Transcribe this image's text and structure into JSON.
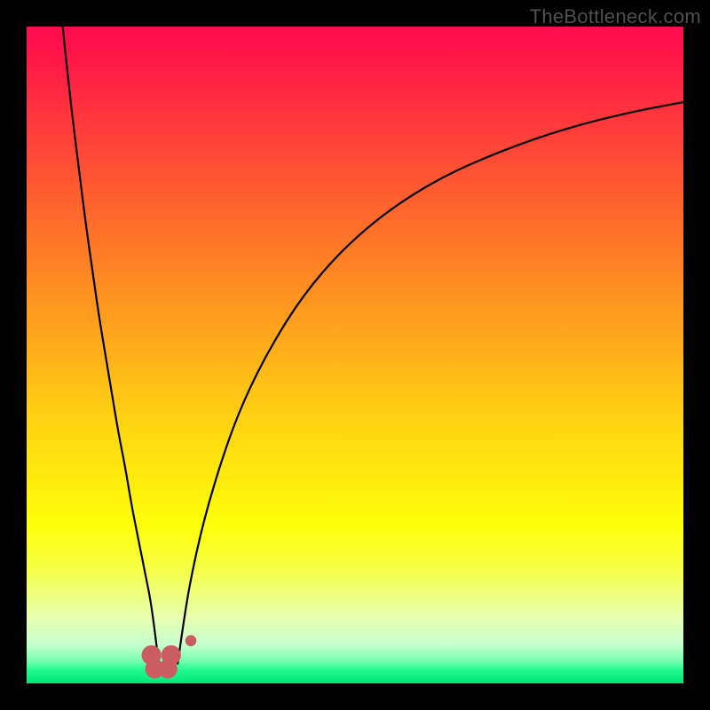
{
  "watermark": "TheBottleneck.com",
  "chart_data": {
    "type": "line",
    "title": "",
    "xlabel": "",
    "ylabel": "",
    "xlim": [
      0,
      100
    ],
    "ylim": [
      0,
      100
    ],
    "grid": false,
    "gradient_stops": [
      {
        "offset": 0.0,
        "color": "#ff0c52"
      },
      {
        "offset": 0.03,
        "color": "#ff1149"
      },
      {
        "offset": 0.35,
        "color": "#ff7e25"
      },
      {
        "offset": 0.6,
        "color": "#ffd312"
      },
      {
        "offset": 0.76,
        "color": "#feff0b"
      },
      {
        "offset": 0.82,
        "color": "#f7ff3f"
      },
      {
        "offset": 0.9,
        "color": "#e8ffb0"
      },
      {
        "offset": 0.94,
        "color": "#c7ffce"
      },
      {
        "offset": 0.965,
        "color": "#7bffb2"
      },
      {
        "offset": 0.98,
        "color": "#21f98d"
      },
      {
        "offset": 1.0,
        "color": "#00e877"
      }
    ],
    "series": [
      {
        "name": "left-curve",
        "stroke": "#000000",
        "width": 2.2,
        "points": [
          {
            "x": 5.5,
            "y": 100
          },
          {
            "x": 6.0,
            "y": 95
          },
          {
            "x": 7.0,
            "y": 86
          },
          {
            "x": 8.0,
            "y": 78
          },
          {
            "x": 9.0,
            "y": 70
          },
          {
            "x": 10.0,
            "y": 63
          },
          {
            "x": 11.0,
            "y": 56
          },
          {
            "x": 12.0,
            "y": 50
          },
          {
            "x": 13.0,
            "y": 44
          },
          {
            "x": 14.0,
            "y": 38
          },
          {
            "x": 15.0,
            "y": 33
          },
          {
            "x": 16.0,
            "y": 27
          },
          {
            "x": 17.0,
            "y": 22
          },
          {
            "x": 18.0,
            "y": 17
          },
          {
            "x": 19.0,
            "y": 12
          },
          {
            "x": 20.0,
            "y": 4
          }
        ]
      },
      {
        "name": "right-curve",
        "stroke": "#000000",
        "width": 2.2,
        "points": [
          {
            "x": 23.0,
            "y": 3
          },
          {
            "x": 24.0,
            "y": 10
          },
          {
            "x": 25.0,
            "y": 16
          },
          {
            "x": 27.0,
            "y": 25
          },
          {
            "x": 30.0,
            "y": 35
          },
          {
            "x": 33.0,
            "y": 43
          },
          {
            "x": 37.0,
            "y": 51
          },
          {
            "x": 42.0,
            "y": 59
          },
          {
            "x": 48.0,
            "y": 66
          },
          {
            "x": 55.0,
            "y": 72
          },
          {
            "x": 63.0,
            "y": 77
          },
          {
            "x": 72.0,
            "y": 81
          },
          {
            "x": 82.0,
            "y": 84.5
          },
          {
            "x": 92.0,
            "y": 87
          },
          {
            "x": 100.0,
            "y": 88.5
          }
        ]
      }
    ],
    "markers": [
      {
        "name": "blob-left",
        "cx": 19.0,
        "cy": 4.3,
        "r": 1.5,
        "color": "#cb5d62"
      },
      {
        "name": "blob-bottom-l",
        "cx": 19.5,
        "cy": 2.2,
        "r": 1.45,
        "color": "#cb5d62"
      },
      {
        "name": "blob-bottom-r",
        "cx": 21.5,
        "cy": 2.2,
        "r": 1.45,
        "color": "#cb5d62"
      },
      {
        "name": "blob-right",
        "cx": 22.0,
        "cy": 4.3,
        "r": 1.5,
        "color": "#cb5d62"
      },
      {
        "name": "dot-separate",
        "cx": 25.0,
        "cy": 6.5,
        "r": 0.85,
        "color": "#cb5d62"
      }
    ]
  }
}
